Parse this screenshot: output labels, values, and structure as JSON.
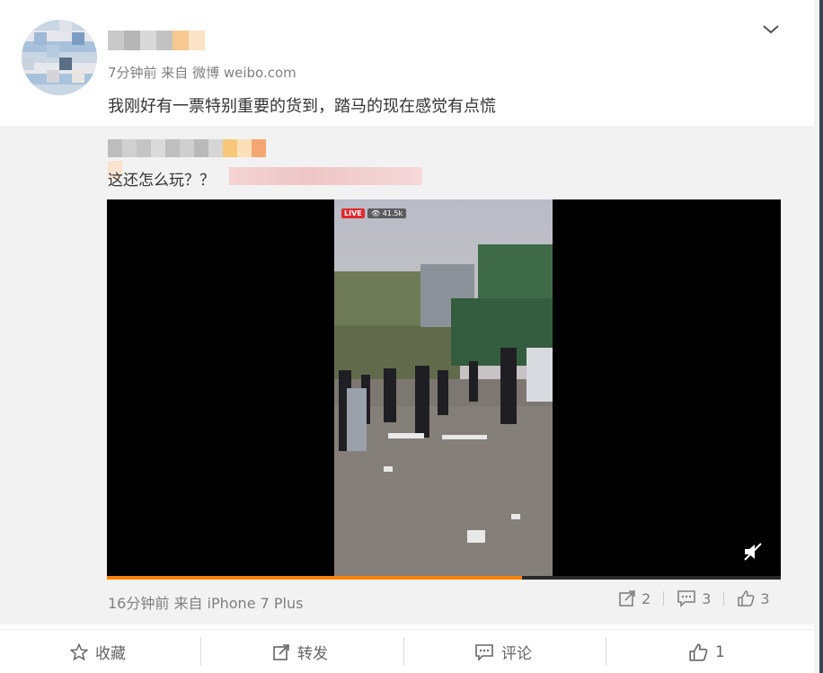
{
  "post": {
    "meta": "7分钟前 来自 微博 weibo.com",
    "text": "我刚好有一票特别重要的货到，踏马的现在感觉有点慌"
  },
  "repost": {
    "text": "这还怎么玩？？",
    "video": {
      "live_label": "LIVE",
      "viewers": "41.5k",
      "progress": 0.616
    },
    "footer_meta": "16分钟前 来自 iPhone 7 Plus",
    "stats": {
      "reposts": "2",
      "comments": "3",
      "likes": "3"
    }
  },
  "actions": {
    "favorite": "收藏",
    "repost": "转发",
    "comment": "评论",
    "like": "1"
  },
  "colors": {
    "accent": "#ff8200",
    "live": "#e0292e"
  }
}
